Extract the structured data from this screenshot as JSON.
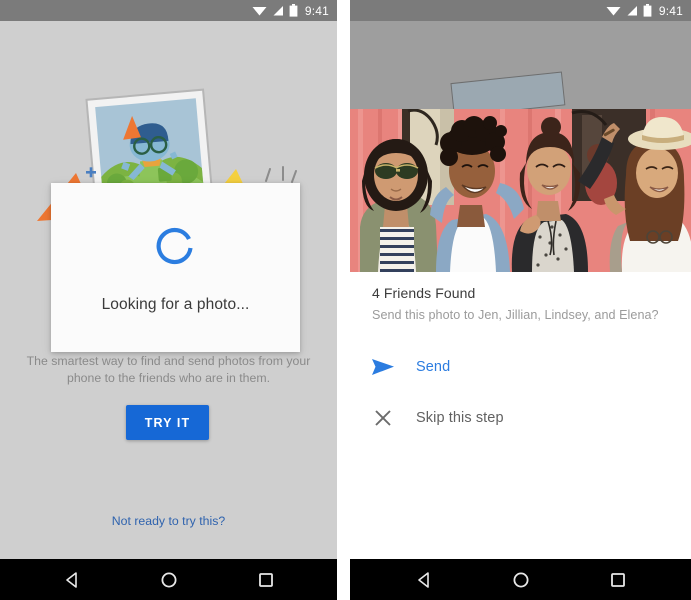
{
  "status_bar": {
    "time": "9:41",
    "icons": [
      "wifi-icon",
      "signal-icon",
      "battery-icon"
    ]
  },
  "colors": {
    "accent_blue": "#1668d6",
    "link_blue": "#2f63ae",
    "send_blue": "#2b7ce0",
    "spinner_blue": "#2b7de0",
    "left_background": "#cfcfcf",
    "status_bar": "#7b7b7b",
    "nav_bar": "#000000"
  },
  "left_screen": {
    "name": "onboarding-screen",
    "illustration": "photo-frame-party-illustration",
    "dialog": {
      "spinner": "loading-spinner",
      "text": "Looking for a photo..."
    },
    "caption": "The smartest way to find and send photos from your phone to the friends who are in them.",
    "primary_button": "TRY IT",
    "secondary_link": "Not ready to try this?"
  },
  "right_screen": {
    "name": "friends-found-screen",
    "photo_alt": "four-women-posing-photo",
    "title": "4 Friends Found",
    "subtitle": "Send this photo to Jen, Jillian, Lindsey, and Elena?",
    "actions": [
      {
        "icon": "send-icon",
        "label": "Send"
      },
      {
        "icon": "close-icon",
        "label": "Skip this step"
      }
    ]
  },
  "nav_bar": {
    "buttons": [
      {
        "icon": "back-icon",
        "label": "Back"
      },
      {
        "icon": "home-icon",
        "label": "Home"
      },
      {
        "icon": "recents-icon",
        "label": "Recents"
      }
    ]
  }
}
